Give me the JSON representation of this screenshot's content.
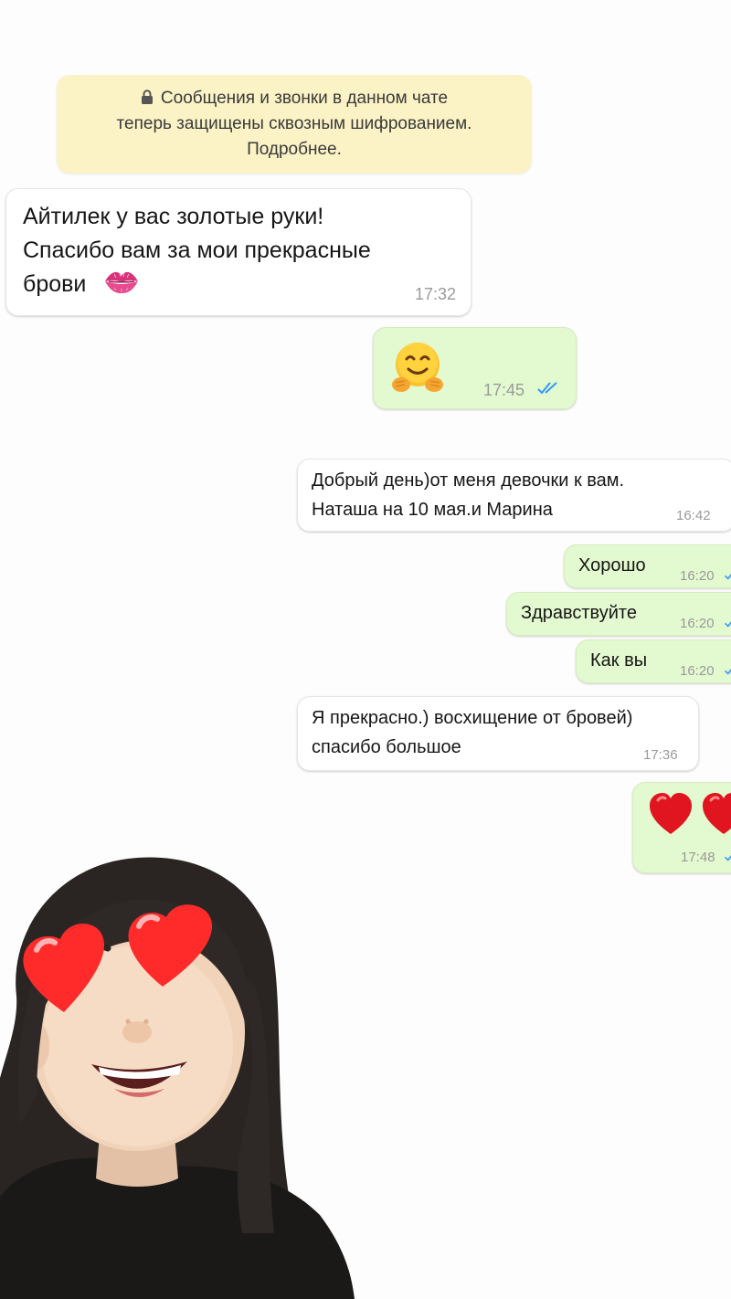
{
  "notice": {
    "line1": "Сообщения и звонки в данном чате",
    "line2": "теперь защищены сквозным шифрованием.",
    "line3": "Подробнее.",
    "icon": "lock-icon"
  },
  "messages": [
    {
      "direction": "incoming",
      "text": "Айтилек у вас золотые руки!\nСпасибо вам за мои прекрасные\nброви",
      "emoji": "kiss-mark-emoji",
      "time": "17:32"
    },
    {
      "direction": "outgoing",
      "emoji": "hugging-face-emoji",
      "time": "17:45",
      "status": "read"
    },
    {
      "direction": "incoming",
      "text": "Добрый день)от меня девочки к вам.\nНаташа на 10 мая.и Марина",
      "time": "16:42"
    },
    {
      "direction": "outgoing",
      "text": "Хорошо",
      "time": "16:20",
      "status": "read"
    },
    {
      "direction": "outgoing",
      "text": "Здравствуйте",
      "time": "16:20",
      "status": "read"
    },
    {
      "direction": "outgoing",
      "text": "Как вы",
      "time": "16:20",
      "status": "read"
    },
    {
      "direction": "incoming",
      "text": "Я прекрасно.) восхищение от бровей)\nспасибо большое",
      "time": "17:36"
    },
    {
      "direction": "outgoing",
      "emoji": "red-hearts-emoji",
      "time": "17:48",
      "status": "read"
    }
  ],
  "avatar": {
    "icon": "heart-eyes-memoji"
  },
  "colors": {
    "incoming_bubble": "#ffffff",
    "outgoing_bubble": "#e3f9cf",
    "notice_bg": "#fbf3c6",
    "read_ticks": "#3497f9",
    "timestamp": "#9a9a9a"
  }
}
